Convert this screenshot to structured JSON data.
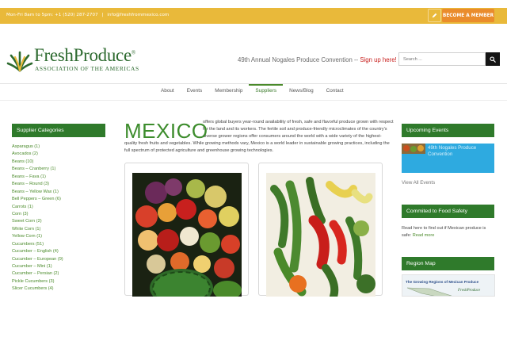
{
  "topbar": {
    "hours": "Mon-Fri 8am to 5pm:",
    "phone": "+1 (520) 287-2707",
    "email": "info@freshfrommexico.com",
    "member_button": "BECOME A MEMBER",
    "pencil_icon": "pencil-icon"
  },
  "header": {
    "logo_title": "FreshProduce",
    "logo_registered": "®",
    "logo_subtitle": "ASSOCIATION OF THE AMERICAS",
    "convention_text": "49th Annual Nogales Produce Convention -- ",
    "signup_text": "Sign up here!",
    "search_placeholder": "Search ..."
  },
  "nav": {
    "items": [
      {
        "label": "About"
      },
      {
        "label": "Events"
      },
      {
        "label": "Membership"
      },
      {
        "label": "Suppliers"
      },
      {
        "label": "News/Blog"
      },
      {
        "label": "Contact"
      }
    ],
    "active": "Suppliers"
  },
  "left_sidebar": {
    "title": "Supplier Categories",
    "categories": [
      "Asparagus (1)",
      "Avocados (2)",
      "Beans (10)",
      "Beans – Cranberry (1)",
      "Beans – Fava (1)",
      "Beans – Round (3)",
      "Beans – Yellow Wax (1)",
      "Bell Peppers – Green (6)",
      "Carrots (1)",
      "Corn (3)",
      "Sweet Corn (2)",
      "White Corn (1)",
      "Yellow Corn (1)",
      "Cucumbers (51)",
      "Cucumber – English (4)",
      "Cucumber – European (9)",
      "Cucumber – Mini (1)",
      "Cucumber – Persian (2)",
      "Pickle Cucumbers (3)",
      "Slicer Cucumbers (4)"
    ]
  },
  "main": {
    "title": "MEXICO",
    "intro": "offers global buyers year-round availability of fresh, safe and flavorful produce grown with respect for the land and its workers. The fertile soil and produce-friendly microclimates of the country's diverse grower regions offer consumers around the world with a wide variety of the highest-quality fresh fruits and vegetables. While growing methods vary, Mexico is a world leader in sustainable growing practices, including the full spectrum of protected agriculture and greenhouse growing technologies."
  },
  "right_sidebar": {
    "upcoming_title": "Upcoming Events",
    "event_title": "49th Nogales Produce Convention",
    "view_all": "View All Events",
    "food_safety_title": "Commited to Food Safety",
    "food_safety_text": "Read here to find out if Mexican produce is safe: ",
    "read_more": "Read more",
    "region_map_title": "Region Map",
    "map_caption": "The Growing Regions of Mexican Produce",
    "map_logo": "FreshProduce"
  },
  "colors": {
    "topbar": "#e9b93a",
    "member_button": "#ea8c2c",
    "brand_green": "#2f7a2b",
    "link_green": "#4a8a2a",
    "signup_red": "#c8201e",
    "event_blue": "#2eaae0"
  }
}
